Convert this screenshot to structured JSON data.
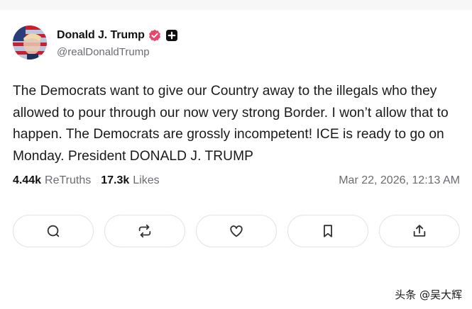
{
  "user": {
    "display_name": "Donald J. Trump",
    "handle": "@realDonaldTrump",
    "avatar_icon": "flag-portrait-avatar",
    "verified_icon": "verified-check-icon",
    "verified_color": "#e5486c",
    "plus_badge_icon": "plus-badge-icon"
  },
  "post": {
    "text": "The Democrats want to give our Country away to the illegals who they allowed to pour through our now very strong Border. I won’t allow that to happen. The Democrats are grossly incompetent! ICE is ready to go on Monday. President DONALD J. TRUMP",
    "retruths_count": "4.44k",
    "retruths_label": "ReTruths",
    "likes_count": "17.3k",
    "likes_label": "Likes",
    "timestamp": "Mar 22, 2026, 12:13 AM"
  },
  "actions": [
    {
      "name": "reply",
      "icon": "comment-icon"
    },
    {
      "name": "retruth",
      "icon": "repost-icon"
    },
    {
      "name": "like",
      "icon": "heart-icon"
    },
    {
      "name": "bookmark",
      "icon": "bookmark-icon"
    },
    {
      "name": "share",
      "icon": "share-icon"
    }
  ],
  "watermark": "头条 @吴大辉"
}
